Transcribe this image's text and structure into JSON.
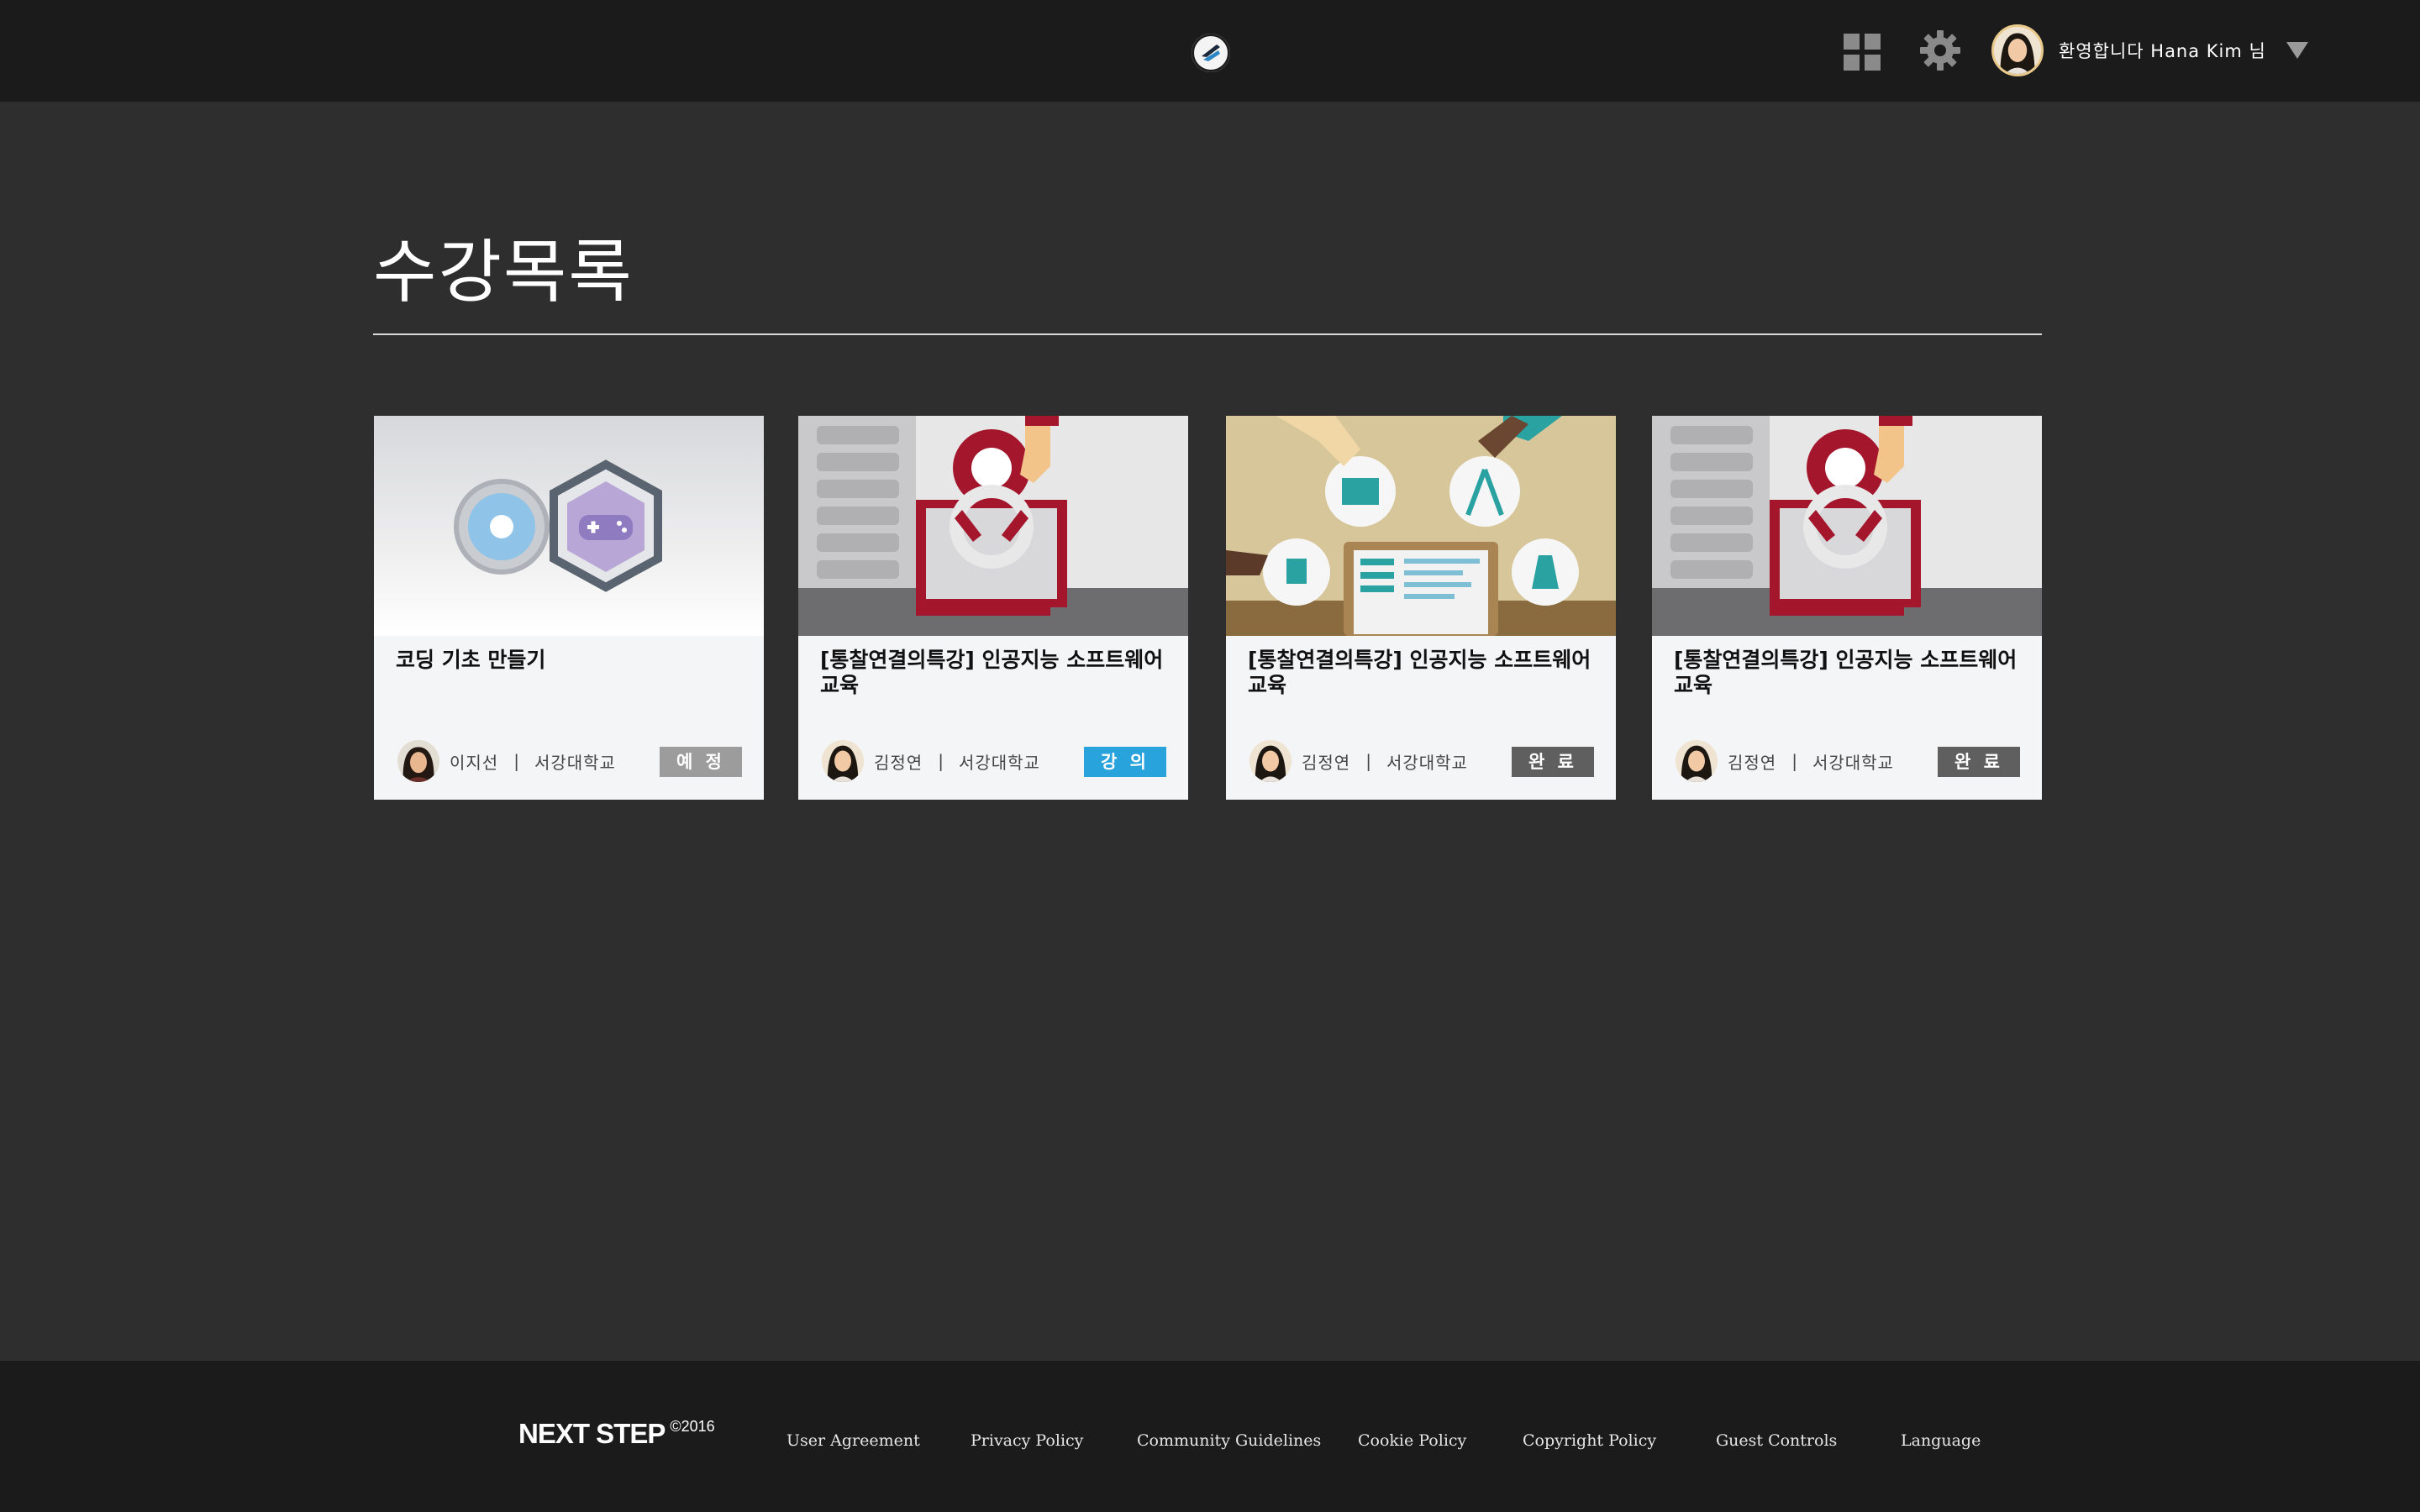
{
  "header": {
    "welcome_text": "환영합니다 Hana Kim 님"
  },
  "page": {
    "title": "수강목록"
  },
  "courses": [
    {
      "title": "코딩 기초 만들기",
      "instructor": "이지선",
      "school": "서강대학교",
      "status": "예 정"
    },
    {
      "title": "[통찰연결의특강] 인공지능 소프트웨어 교육",
      "instructor": "김정연",
      "school": "서강대학교",
      "status": "강 의"
    },
    {
      "title": "[통찰연결의특강] 인공지능 소프트웨어 교육",
      "instructor": "김정연",
      "school": "서강대학교",
      "status": "완 료"
    },
    {
      "title": "[통찰연결의특강] 인공지능 소프트웨어 교육",
      "instructor": "김정연",
      "school": "서강대학교",
      "status": "완 료"
    }
  ],
  "colors": {
    "status_upcoming": "#9c9c9c",
    "status_lecture": "#29a3dc",
    "status_done": "#5f5f5f"
  },
  "footer": {
    "brand": "NEXT STEP",
    "copyright": "©2016",
    "links": [
      "User Agreement",
      "Privacy Policy",
      "Community Guidelines",
      "Cookie Policy",
      "Copyright Policy",
      "Guest Controls",
      "Language"
    ]
  }
}
